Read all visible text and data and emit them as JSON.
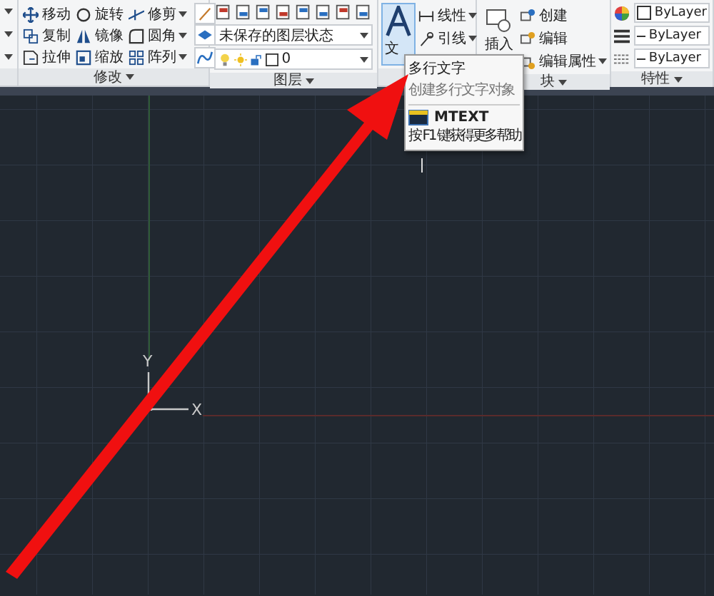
{
  "modify": {
    "label": "修改",
    "tools": [
      {
        "label": "移动",
        "caret": false
      },
      {
        "label": "旋转",
        "caret": false
      },
      {
        "label": "修剪",
        "caret": true
      },
      {
        "label": "复制",
        "caret": false
      },
      {
        "label": "镜像",
        "caret": false
      },
      {
        "label": "圆角",
        "caret": true
      },
      {
        "label": "拉伸",
        "caret": false
      },
      {
        "label": "缩放",
        "caret": false
      },
      {
        "label": "阵列",
        "caret": true
      }
    ]
  },
  "layers": {
    "label": "图层",
    "layer_state": "未保存的图层状态",
    "current_layer": "0"
  },
  "annotation": {
    "big_button": "文",
    "selected": true,
    "tools": [
      {
        "label": "线性",
        "caret": true
      },
      {
        "label": "引线",
        "caret": true
      }
    ]
  },
  "block": {
    "label": "块",
    "big_button": "插入",
    "tools": [
      {
        "label": "创建",
        "caret": false
      },
      {
        "label": "编辑",
        "caret": false
      },
      {
        "label": "编辑属性",
        "caret": true
      }
    ]
  },
  "properties": {
    "label": "特性",
    "rows": [
      "ByLayer",
      "ByLayer",
      "ByLayer"
    ]
  },
  "tooltip": {
    "title": "多行文字",
    "description": "创建多行文字对象",
    "command": "MTEXT",
    "help": "按 F1 键获得更多帮助"
  },
  "canvas": {
    "x_label": "X",
    "y_label": "Y"
  }
}
